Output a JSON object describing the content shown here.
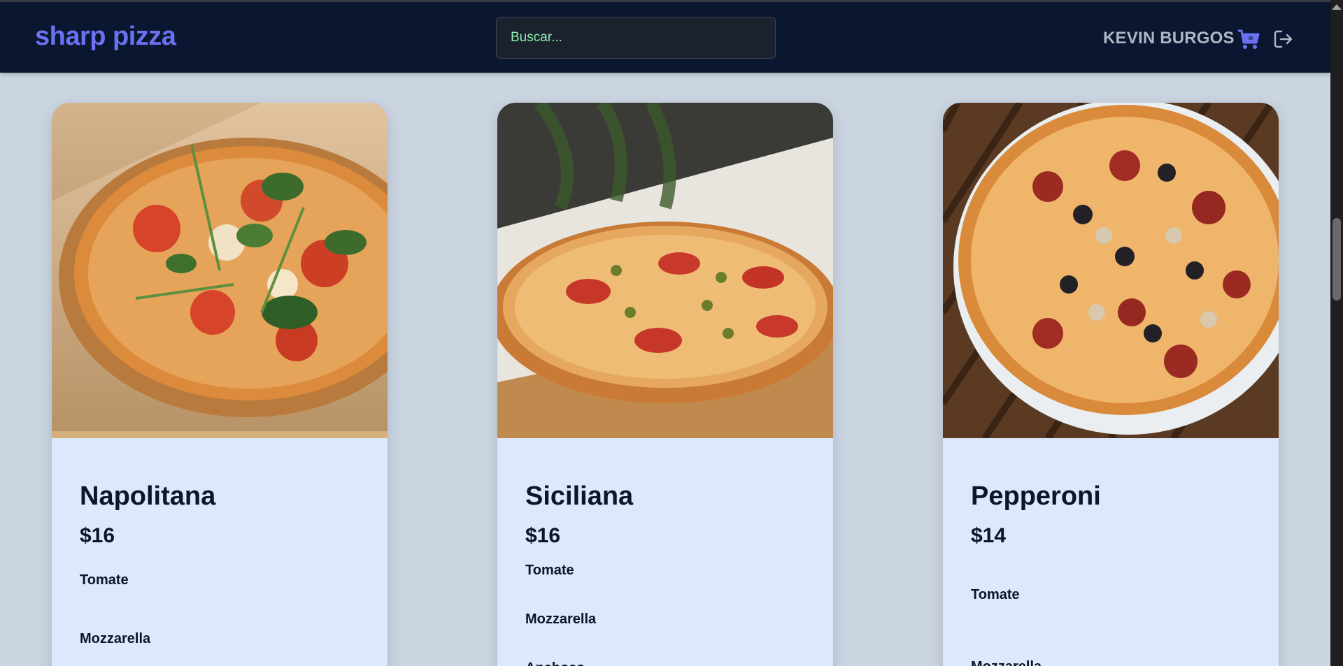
{
  "header": {
    "brand": "sharp pizza",
    "search_placeholder": "Buscar...",
    "username": "KEVIN BURGOS",
    "cart_icon": "cart-icon",
    "logout_icon": "logout-icon"
  },
  "colors": {
    "navbar_bg": "#0b1730",
    "brand": "#6a72f2",
    "page_bg": "#cbd5e1",
    "card_bg": "#dbe8fd",
    "search_text": "#8ef0b3"
  },
  "products": [
    {
      "name": "Napolitana",
      "price": "$16",
      "ingredients": [
        "Tomate",
        "Mozzarella"
      ]
    },
    {
      "name": "Siciliana",
      "price": "$16",
      "ingredients": [
        "Tomate",
        "Mozzarella",
        "Anchoas"
      ]
    },
    {
      "name": "Pepperoni",
      "price": "$14",
      "ingredients": [
        "Tomate",
        "Mozzarella"
      ]
    }
  ]
}
